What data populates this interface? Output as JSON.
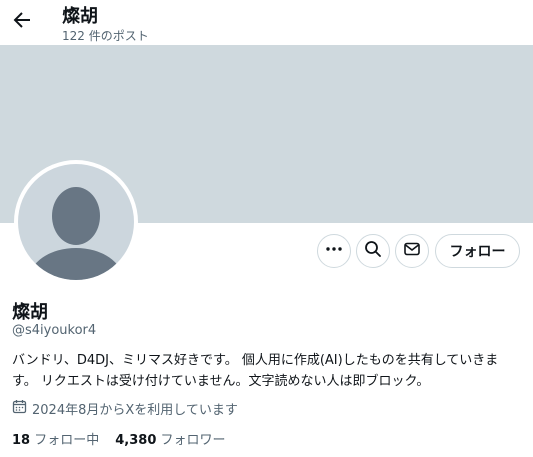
{
  "header": {
    "name": "燦胡",
    "post_count": "122 件のポスト"
  },
  "profile": {
    "display_name": "燦胡",
    "handle": "@s4iyoukor4",
    "bio_line1": "バンドリ、D4DJ、ミリマス好きです。 個人用に作成(AI)したものを共有していきま",
    "bio_line2": "す。 リクエストは受け付けていません。文字読めない人は即ブロック。",
    "joined": "2024年8月からXを利用しています",
    "following_count": "18",
    "following_label": "フォロー中",
    "followers_count": "4,380",
    "followers_label": "フォロワー"
  },
  "actions": {
    "follow_label": "フォロー"
  },
  "icons": [
    "back-arrow-icon",
    "more-icon",
    "search-icon",
    "message-icon",
    "calendar-icon",
    "default-avatar-icon"
  ],
  "colors": {
    "banner": "#cfd9de",
    "avatar_bg": "#ccd6dd",
    "avatar_figure": "#687684",
    "muted_text": "#536471",
    "text": "#0f1419"
  }
}
